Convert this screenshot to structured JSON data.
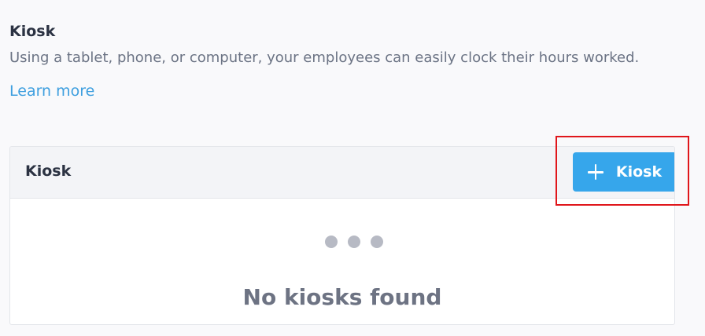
{
  "section": {
    "title": "Kiosk",
    "description": "Using a tablet, phone, or computer, your employees can easily clock their hours worked.",
    "learn_more": "Learn more"
  },
  "panel": {
    "title": "Kiosk",
    "add_button_label": "Kiosk",
    "add_button_icon": "plus-icon",
    "loading_icon": "loading-dots-icon",
    "empty_text": "No kiosks found"
  },
  "colors": {
    "accent": "#36a6eb",
    "link": "#3e9fdf",
    "highlight": "#e0161b"
  }
}
